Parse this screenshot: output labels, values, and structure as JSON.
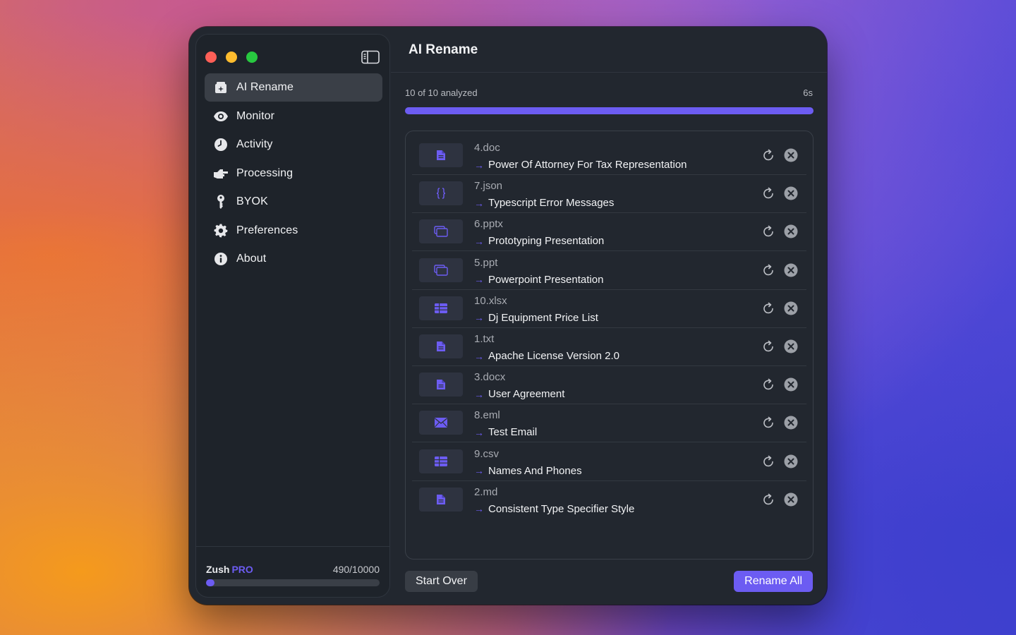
{
  "app": {
    "title": "AI Rename",
    "accent_color": "#6c5cf2"
  },
  "sidebar": {
    "items": [
      {
        "label": "AI Rename",
        "icon": "ai-rename-icon",
        "active": true
      },
      {
        "label": "Monitor",
        "icon": "eye-icon",
        "active": false
      },
      {
        "label": "Activity",
        "icon": "clock-icon",
        "active": false
      },
      {
        "label": "Processing",
        "icon": "hand-point-icon",
        "active": false
      },
      {
        "label": "BYOK",
        "icon": "key-icon",
        "active": false
      },
      {
        "label": "Preferences",
        "icon": "gear-icon",
        "active": false
      },
      {
        "label": "About",
        "icon": "info-icon",
        "active": false
      }
    ],
    "footer": {
      "plan_name": "Zush",
      "plan_tier": "PRO",
      "usage_text": "490/10000",
      "usage_fraction": 0.049
    }
  },
  "progress": {
    "label": "10 of 10 analyzed",
    "time": "6s",
    "fraction": 1.0
  },
  "files": [
    {
      "original": "4.doc",
      "suggested": "Power Of Attorney For Tax Representation",
      "icon": "document-icon"
    },
    {
      "original": "7.json",
      "suggested": "Typescript Error Messages",
      "icon": "code-braces-icon"
    },
    {
      "original": "6.pptx",
      "suggested": "Prototyping Presentation",
      "icon": "slides-icon"
    },
    {
      "original": "5.ppt",
      "suggested": "Powerpoint Presentation",
      "icon": "slides-icon"
    },
    {
      "original": "10.xlsx",
      "suggested": "Dj Equipment Price List",
      "icon": "table-icon"
    },
    {
      "original": "1.txt",
      "suggested": "Apache License Version 2.0",
      "icon": "document-icon"
    },
    {
      "original": "3.docx",
      "suggested": "User Agreement",
      "icon": "document-icon"
    },
    {
      "original": "8.eml",
      "suggested": "Test Email",
      "icon": "envelope-icon"
    },
    {
      "original": "9.csv",
      "suggested": "Names And Phones",
      "icon": "table-icon"
    },
    {
      "original": "2.md",
      "suggested": "Consistent Type Specifier Style",
      "icon": "document-icon"
    }
  ],
  "actions": {
    "start_over": "Start Over",
    "rename_all": "Rename All"
  }
}
